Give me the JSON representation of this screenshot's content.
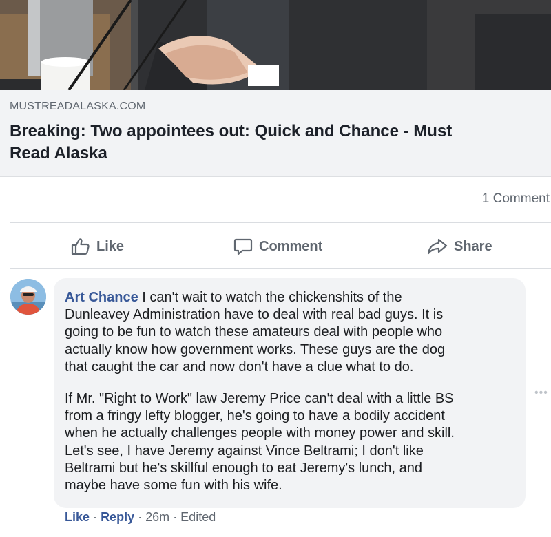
{
  "link_preview": {
    "domain": "MUSTREADALASKA.COM",
    "title": "Breaking: Two appointees out: Quick and Chance - Must\nRead Alaska"
  },
  "post_stats": {
    "comment_count": "1 Comment"
  },
  "actions": {
    "like": "Like",
    "comment": "Comment",
    "share": "Share"
  },
  "comment": {
    "author": "Art Chance",
    "paragraph1": "I can't wait to watch the chickenshits of the\nDunleavey Administration have to deal with real bad guys. It is\ngoing to be fun to watch these amateurs deal with people who\nactually know how government works. These guys are the dog\nthat caught the car and now don't have a clue what to do.",
    "paragraph2": "If Mr. \"Right to Work\" law Jeremy Price can't deal with a little BS\nfrom a fringy lefty blogger, he's going to have a bodily accident\nwhen he actually challenges people with money power and skill.\nLet's see, I have Jeremy against Vince Beltrami; I don't like\nBeltrami but he's skillful enough to eat Jeremy's lunch, and\nmaybe have some fun with his wife.",
    "like": "Like",
    "reply": "Reply",
    "time": "26m",
    "edited": "Edited",
    "sep": "·",
    "more": "•••"
  },
  "icons": {
    "like": "thumbs-up-icon",
    "comment": "speech-bubble-icon",
    "share": "share-arrow-icon",
    "more": "more-options-icon"
  },
  "colors": {
    "link": "#385898",
    "secondary_text": "#606770",
    "bubble_bg": "#f2f3f5",
    "preview_bg": "#f2f3f5"
  }
}
